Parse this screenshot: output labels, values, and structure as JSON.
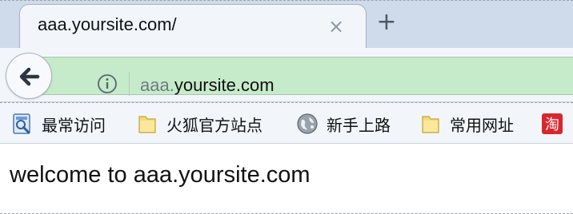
{
  "tab": {
    "title": "aaa.yoursite.com/",
    "close_glyph": "×",
    "new_tab_glyph": "+"
  },
  "navbar": {
    "back_icon": "back-arrow-icon",
    "info_icon": "info-icon",
    "url_subdomain": "aaa.",
    "url_domain": "yoursite.com",
    "url_bar_color": "#c6ebca"
  },
  "bookmarks": {
    "items": [
      {
        "label": "最常访问",
        "icon": "most-visited-icon"
      },
      {
        "label": "火狐官方站点",
        "icon": "folder-icon"
      },
      {
        "label": "新手上路",
        "icon": "globe-icon"
      },
      {
        "label": "常用网址",
        "icon": "folder-icon"
      },
      {
        "label": "淘",
        "icon": "taobao-icon"
      }
    ]
  },
  "page": {
    "welcome_text": "welcome to aaa.yoursite.com"
  }
}
